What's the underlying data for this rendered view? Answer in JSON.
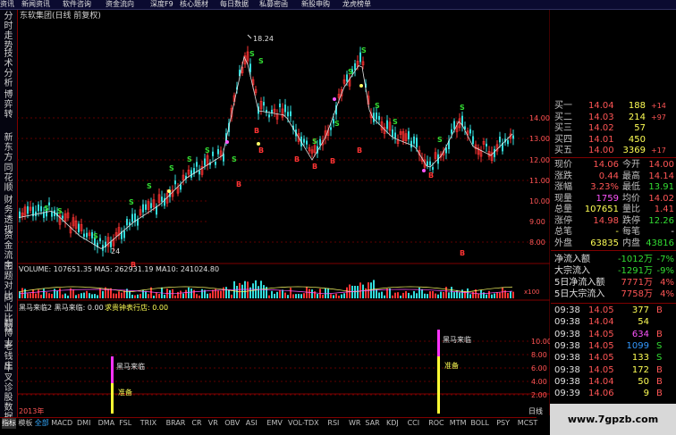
{
  "top_menu": [
    "资讯",
    "新闻资讯",
    "软件咨询",
    "资金流向",
    "深度F9",
    "核心题材",
    "每日数据",
    "私募密函",
    "新股申购",
    "龙虎榜单"
  ],
  "left_sidebar": [
    "分时走势",
    "技术分析",
    "博弈转",
    "新东方",
    "同花顺",
    "财务透视",
    "资金流向",
    "主题对比",
    "同业比较",
    "翻博士",
    "老钱庄",
    "牛叉诊股",
    "数据"
  ],
  "chart": {
    "title": "东软集团(日线 前复权)",
    "high_label": "18.24",
    "low_label": "24",
    "price_ticks": [
      "14.00",
      "13.00",
      "12.00",
      "11.00",
      "10.00",
      "9.00",
      "8.00"
    ],
    "volume_header": "VOLUME: 107651.35  MA5: 262931.19  MA10: 241024.80",
    "volume_unit": "x100",
    "indicator_header_1": "黑马来临2  黑马来临: 0.00",
    "indicator_header_2": "求贵钟表行店: 0.00",
    "indicator_ticks": [
      "10.00",
      "8.00",
      "6.00",
      "4.00",
      "2.00"
    ],
    "annotation_1": "黑马来临",
    "annotation_2": "准备",
    "year_label": "2013年",
    "bottom_right_label": "日线",
    "signal_s": "S",
    "signal_b": "B"
  },
  "order_book": [
    {
      "label": "买一",
      "price": "14.04",
      "vol": "188",
      "chg": "+14"
    },
    {
      "label": "买二",
      "price": "14.03",
      "vol": "214",
      "chg": "+97"
    },
    {
      "label": "买三",
      "price": "14.02",
      "vol": "57",
      "chg": ""
    },
    {
      "label": "买四",
      "price": "14.01",
      "vol": "450",
      "chg": ""
    },
    {
      "label": "买五",
      "price": "14.00",
      "vol": "3369",
      "chg": "+17"
    }
  ],
  "quote": [
    {
      "l1": "现价",
      "v1": "14.06",
      "l2": "今开",
      "v2": "14.00"
    },
    {
      "l1": "涨跌",
      "v1": "0.44",
      "l2": "最高",
      "v2": "14.14"
    },
    {
      "l1": "涨幅",
      "v1": "3.23%",
      "l2": "最低",
      "v2": "13.91"
    },
    {
      "l1": "现量",
      "v1": "1759",
      "l2": "均价",
      "v2": "14.02"
    },
    {
      "l1": "总量",
      "v1": "107651",
      "l2": "量比",
      "v2": "1.41"
    },
    {
      "l1": "涨停",
      "v1": "14.98",
      "l2": "跌停",
      "v2": "12.26"
    },
    {
      "l1": "总笔",
      "v1": "-",
      "l2": "每笔",
      "v2": "-"
    },
    {
      "l1": "外盘",
      "v1": "63835",
      "l2": "内盘",
      "v2": "43816"
    }
  ],
  "flows": [
    {
      "label": "净流入额",
      "value": "-1012万",
      "pct": "-7%"
    },
    {
      "label": "大宗流入",
      "value": "-1291万",
      "pct": "-9%"
    },
    {
      "label": "5日净流入额",
      "value": "7771万",
      "pct": "4%"
    },
    {
      "label": "5日大宗流入",
      "value": "7758万",
      "pct": "4%"
    }
  ],
  "ticks": [
    {
      "time": "09:38",
      "price": "14.05",
      "vol": "377",
      "bs": "B"
    },
    {
      "time": "09:38",
      "price": "14.04",
      "vol": "54",
      "bs": ""
    },
    {
      "time": "09:38",
      "price": "14.05",
      "vol": "634",
      "bs": "B"
    },
    {
      "time": "09:38",
      "price": "14.05",
      "vol": "1099",
      "bs": "S"
    },
    {
      "time": "09:38",
      "price": "14.05",
      "vol": "133",
      "bs": "S"
    },
    {
      "time": "09:38",
      "price": "14.05",
      "vol": "172",
      "bs": "B"
    },
    {
      "time": "09:38",
      "price": "14.04",
      "vol": "50",
      "bs": "B"
    },
    {
      "time": "09:39",
      "price": "14.06",
      "vol": "9",
      "bs": "B"
    }
  ],
  "tabs": [
    "指标",
    "模板",
    "全部",
    "MACD",
    "DMI",
    "DMA",
    "FSL",
    "TRIX",
    "BRAR",
    "CR",
    "VR",
    "OBV",
    "ASI",
    "EMV",
    "VOL-TDX",
    "RSI",
    "WR",
    "SAR",
    "KDJ",
    "CCI",
    "ROC",
    "MTM",
    "BOLL",
    "PSY",
    "MCST"
  ],
  "watermark": "www.7gpzb.com"
}
